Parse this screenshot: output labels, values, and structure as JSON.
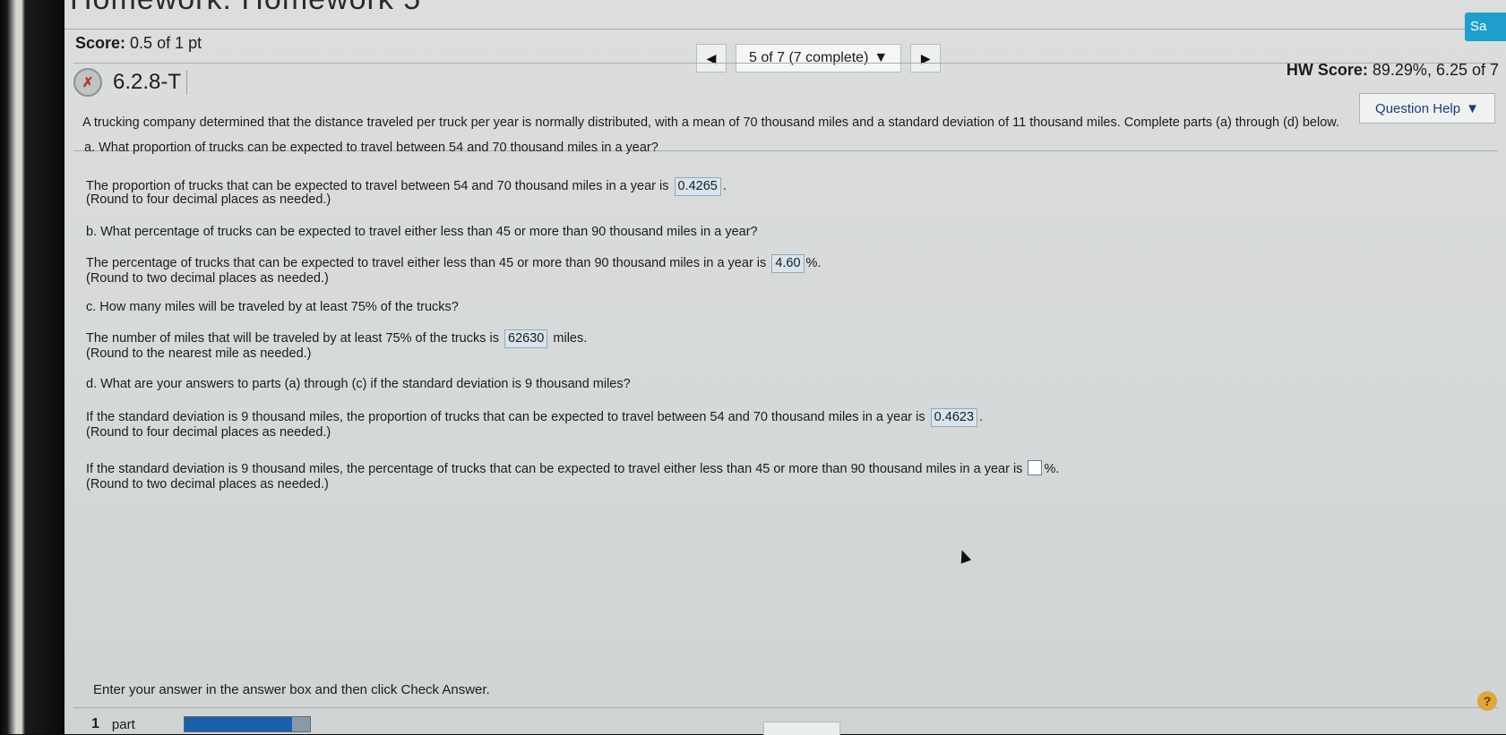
{
  "header": {
    "title_partial": "Homework: Homework 5",
    "save_label": "Sa",
    "score_label": "Score:",
    "score_value": "0.5 of 1 pt",
    "nav_position": "5 of 7 (7 complete)",
    "hw_score_label": "HW Score:",
    "hw_score_value": "89.29%, 6.25 of 7",
    "question_id": "6.2.8-T",
    "question_help_label": "Question Help"
  },
  "question": {
    "intro": "A trucking company determined that the distance traveled per truck per year is normally distributed, with a mean of 70 thousand miles and a standard deviation of 11 thousand miles. Complete parts (a) through (d) below.",
    "a_prompt": "a. What proportion of trucks can be expected to travel between 54 and 70 thousand miles in a year?",
    "a_answer_pre": "The proportion of trucks that can be expected to travel between 54 and 70 thousand miles in a year is",
    "a_answer": "0.4265",
    "a_answer_post": ".",
    "a_round": "(Round to four decimal places as needed.)",
    "b_prompt": "b. What percentage of trucks can be expected to travel either less than 45 or more than 90 thousand miles in a year?",
    "b_answer_pre": "The percentage of trucks that can be expected to travel either less than 45 or more than 90 thousand miles in a year is",
    "b_answer": "4.60",
    "b_answer_post": "%.",
    "b_round": "(Round to two decimal places as needed.)",
    "c_prompt": "c. How many miles will be traveled by at least 75% of the trucks?",
    "c_answer_pre": "The number of miles that will be traveled by at least 75% of the trucks is",
    "c_answer": "62630",
    "c_answer_post": "miles.",
    "c_round": "(Round to the nearest mile as needed.)",
    "d_prompt": "d. What are your answers to parts (a) through (c) if the standard deviation is 9 thousand miles?",
    "d1_answer_pre": "If the standard deviation is 9 thousand miles, the proportion of trucks that can be expected to travel between 54 and 70 thousand miles in a year is",
    "d1_answer": "0.4623",
    "d1_answer_post": ".",
    "d1_round": "(Round to four decimal places as needed.)",
    "d2_answer_pre": "If the standard deviation is 9 thousand miles, the percentage of trucks that can be expected to travel either less than 45 or more than 90 thousand miles in a year is",
    "d2_answer": "",
    "d2_answer_post": "%.",
    "d2_round": "(Round to two decimal places as needed.)"
  },
  "footer": {
    "instruction": "Enter your answer in the answer box and then click Check Answer.",
    "parts_count": "1",
    "parts_label": "part",
    "help_glyph": "?"
  }
}
